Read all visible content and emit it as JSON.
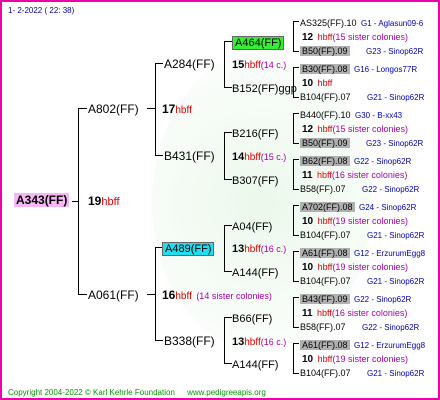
{
  "header": {
    "date": "1-  2-2022",
    "time": "( 22: 38)"
  },
  "footer": {
    "copyright": "Copyright 2004-2022 © Karl Kehrle Foundation",
    "site": "www.pedigreeapis.org"
  },
  "tree": {
    "main": {
      "name": "A343(FF)",
      "count": "19",
      "hbff": "hbff"
    },
    "father": {
      "name": "A802(FF)",
      "count": "17",
      "hbff": "hbff"
    },
    "mother": {
      "name": "A061(FF)",
      "count": "16",
      "hbff": "hbff",
      "sisters": "(14 sister colonies)"
    },
    "ff": {
      "name": "A284(FF)",
      "count": "15",
      "hbff": "hbff",
      "sisters": "(14 c.)"
    },
    "fm": {
      "name": "B431(FF)",
      "count": "14",
      "hbff": "hbff",
      "sisters": "(15 c.)"
    },
    "mf": {
      "name": "A489(FF)",
      "count": "13",
      "hbff": "hbff",
      "sisters": "(16 c.)"
    },
    "mm": {
      "name": "B338(FF)",
      "count": "13",
      "hbff": "hbff",
      "sisters": "(16 c.)"
    },
    "fff": {
      "name": "A464(FF)"
    },
    "ffm": {
      "name": "B152(FF)ggp"
    },
    "fmf": {
      "name": "B216(FF)"
    },
    "fmm": {
      "name": "B307(FF)"
    },
    "mff": {
      "name": "A04(FF)"
    },
    "mfm": {
      "name": "A144(FF)"
    },
    "mmf": {
      "name": "B66(FF)"
    },
    "mmm": {
      "name": "A144(FF)"
    }
  },
  "right": [
    {
      "top": "AS325(FF).10",
      "top_loc": "G1 - Aglasun09-6",
      "count": "12",
      "sisters": "(15 sister colonies)",
      "bottom": "B50(FF).09",
      "bottom_loc": "G23 - Sinop62R",
      "bottom_gray": true
    },
    {
      "top": "B30(FF).08",
      "top_loc": "G16 - Longos77R",
      "top_gray": true,
      "count": "10",
      "sisters": "",
      "bottom": "B104(FF).07",
      "bottom_loc": "G21 - Sinop62R"
    },
    {
      "top": "B440(FF).10",
      "top_loc": "G30 - B-xx43",
      "count": "12",
      "sisters": "(15 sister colonies)",
      "bottom": "B50(FF).09",
      "bottom_loc": "G23 - Sinop62R",
      "bottom_gray": true
    },
    {
      "top": "B62(FF).08",
      "top_loc": "G22 - Sinop62R",
      "top_gray": true,
      "count": "11",
      "sisters": "(16 sister colonies)",
      "bottom": "B58(FF).07",
      "bottom_loc": "G22 - Sinop62R"
    },
    {
      "top": "A702(FF).08",
      "top_loc": "G24 - Sinop62R",
      "top_gray": true,
      "count": "10",
      "sisters": "(19 sister colonies)",
      "bottom": "B104(FF).07",
      "bottom_loc": "G21 - Sinop62R"
    },
    {
      "top": "A61(FF).08",
      "top_loc": "G12 - ErzurumEgg8",
      "top_gray": true,
      "count": "10",
      "sisters": "(19 sister colonies)",
      "bottom": "B104(FF).07",
      "bottom_loc": "G21 - Sinop62R"
    },
    {
      "top": "B43(FF).09",
      "top_loc": "G22 - Sinop62R",
      "top_gray": true,
      "count": "11",
      "sisters": "(16 sister colonies)",
      "bottom": "B58(FF).07",
      "bottom_loc": "G22 - Sinop62R"
    },
    {
      "top": "A61(FF).08",
      "top_loc": "G12 - ErzurumEgg8",
      "top_gray": true,
      "count": "10",
      "sisters": "(19 sister colonies)",
      "bottom": "B104(FF).07",
      "bottom_loc": "G21 - Sinop62R"
    }
  ],
  "colors": {
    "border": "#ee00aa",
    "main_bg": "#f7b7f7",
    "highlight_green": "#33ee33",
    "highlight_cyan": "#22ddee",
    "hbff": "#dd0000",
    "sisters": "#aa00aa",
    "location": "#0000bb"
  }
}
